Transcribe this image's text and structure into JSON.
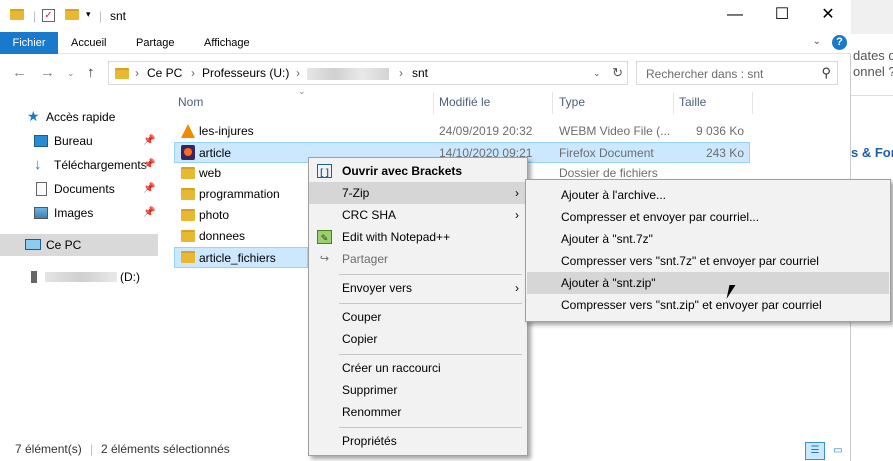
{
  "title": "snt",
  "ribbon": {
    "file": "Fichier",
    "tabs": [
      "Accueil",
      "Partage",
      "Affichage"
    ]
  },
  "address": {
    "crumbs": [
      "Ce PC",
      "Professeurs (U:)",
      "snt"
    ]
  },
  "search": {
    "placeholder": "Rechercher dans : snt"
  },
  "nav": {
    "quick_access": "Accès rapide",
    "items": [
      "Bureau",
      "Téléchargements",
      "Documents",
      "Images"
    ],
    "this_pc": "Ce PC",
    "drive": "(D:)"
  },
  "columns": {
    "name": "Nom",
    "date": "Modifié le",
    "type": "Type",
    "size": "Taille"
  },
  "files": [
    {
      "name": "les-injures",
      "date": "24/09/2019 20:32",
      "type": "WEBM Video File (...",
      "size": "9 036 Ko",
      "icon": "vlc-icon"
    },
    {
      "name": "article",
      "date": "14/10/2020 09:21",
      "type": "Firefox Document",
      "size": "243 Ko",
      "icon": "firefox-icon"
    },
    {
      "name": "web",
      "date": "",
      "type": "Dossier de fichiers",
      "size": "",
      "icon": "folder-icon"
    },
    {
      "name": "programmation",
      "date": "",
      "type": "",
      "size": "",
      "icon": "folder-icon"
    },
    {
      "name": "photo",
      "date": "",
      "type": "",
      "size": "",
      "icon": "folder-icon"
    },
    {
      "name": "donnees",
      "date": "",
      "type": "",
      "size": "",
      "icon": "folder-icon"
    },
    {
      "name": "article_fichiers",
      "date": "",
      "type": "",
      "size": "",
      "icon": "folder-icon"
    }
  ],
  "status": {
    "count": "7 élément(s)",
    "selected": "2 éléments sélectionnés"
  },
  "context_menu": {
    "open_brackets": "Ouvrir avec Brackets",
    "zip7": "7-Zip",
    "crc": "CRC SHA",
    "notepad": "Edit with Notepad++",
    "share": "Partager",
    "send_to": "Envoyer vers",
    "cut": "Couper",
    "copy": "Copier",
    "shortcut": "Créer un raccourci",
    "delete": "Supprimer",
    "rename": "Renommer",
    "properties": "Propriétés"
  },
  "submenu": [
    "Ajouter à l'archive...",
    "Compresser et envoyer par courriel...",
    "Ajouter à \"snt.7z\"",
    "Compresser vers \"snt.7z\" et envoyer par courriel",
    "Ajouter à \"snt.zip\"",
    "Compresser vers \"snt.zip\" et envoyer par courriel"
  ],
  "behind": {
    "line1": "dates de",
    "line2": "onnel ?",
    "line3": "s & For"
  },
  "colors": {
    "accent": "#1979ca",
    "selection": "#cce8ff",
    "folder": "#e8b833"
  }
}
